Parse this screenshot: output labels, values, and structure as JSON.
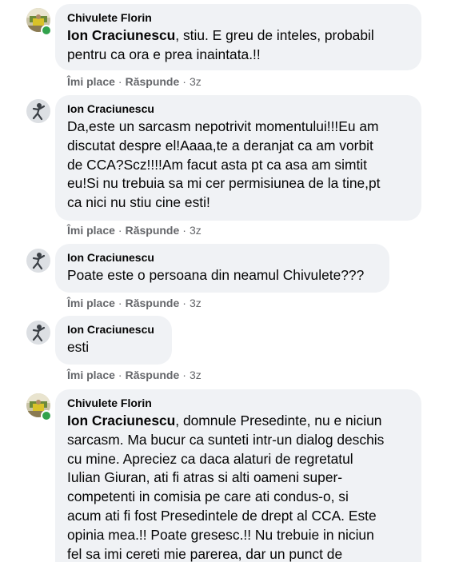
{
  "comments": [
    {
      "author": "Chivulete Florin",
      "mention": "Ion Craciunescu",
      "text": ", stiu. E greu de inteles, probabil\npentru ca ora e prea inaintata.!!",
      "like": "Îmi place",
      "reply": "Răspunde",
      "dot": "·",
      "time": "3z"
    },
    {
      "author": "Ion Craciunescu",
      "text": "Da,este un sarcasm nepotrivit momentului!!!Eu am\ndiscutat despre el!Aaaa,te a deranjat ca am vorbit\nde CCA?Scz!!!!Am facut asta pt ca asa am simtit\neu!Si nu trebuia sa mi cer permisiunea de la tine,pt\nca nici nu stiu cine esti!",
      "like": "Îmi place",
      "reply": "Răspunde",
      "dot": "·",
      "time": "3z"
    },
    {
      "author": "Ion Craciunescu",
      "text": "Poate este o persoana din neamul Chivulete???",
      "like": "Îmi place",
      "reply": "Răspunde",
      "dot": "·",
      "time": "3z"
    },
    {
      "author": "Ion Craciunescu",
      "text": "esti",
      "like": "Îmi place",
      "reply": "Răspunde",
      "dot": "·",
      "time": "3z"
    },
    {
      "author": "Chivulete Florin",
      "mention": "Ion Craciunescu",
      "text": ", domnule Presedinte, nu e niciun\nsarcasm. Ma bucur ca sunteti intr-un dialog deschis\ncu mine. Apreciez ca daca alaturi de regretatul\nIulian Giuran, ati fi atras si alti oameni super-\ncompetenti in comisia pe care ati condus-o, si\nacum ati fi fost Presedintele de drept al CCA. Este\nopinia mea.!! Poate gresesc.!! Nu trebuie in niciun\nfel sa imi cereti mie parerea, dar un punct de"
    }
  ],
  "colors": {
    "bubble": "#f0f2f5",
    "text": "#050505",
    "meta": "#65676b",
    "online": "#31a24c"
  }
}
